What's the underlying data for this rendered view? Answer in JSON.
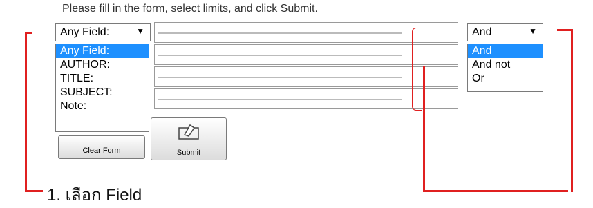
{
  "instruction": "Please fill in the form, select limits, and click Submit.",
  "field_select": {
    "selected": "Any Field:",
    "options": [
      "Any Field:",
      "AUTHOR:",
      "TITLE:",
      "SUBJECT:",
      "Note:"
    ]
  },
  "bool_select": {
    "selected": "And",
    "options": [
      "And",
      "And not",
      "Or"
    ]
  },
  "buttons": {
    "clear": "Clear Form",
    "submit": "Submit"
  },
  "annotation": {
    "bottom_label": "1. เลือก Field"
  },
  "colors": {
    "highlight": "#1e90ff",
    "annotation_red": "#e02020"
  }
}
